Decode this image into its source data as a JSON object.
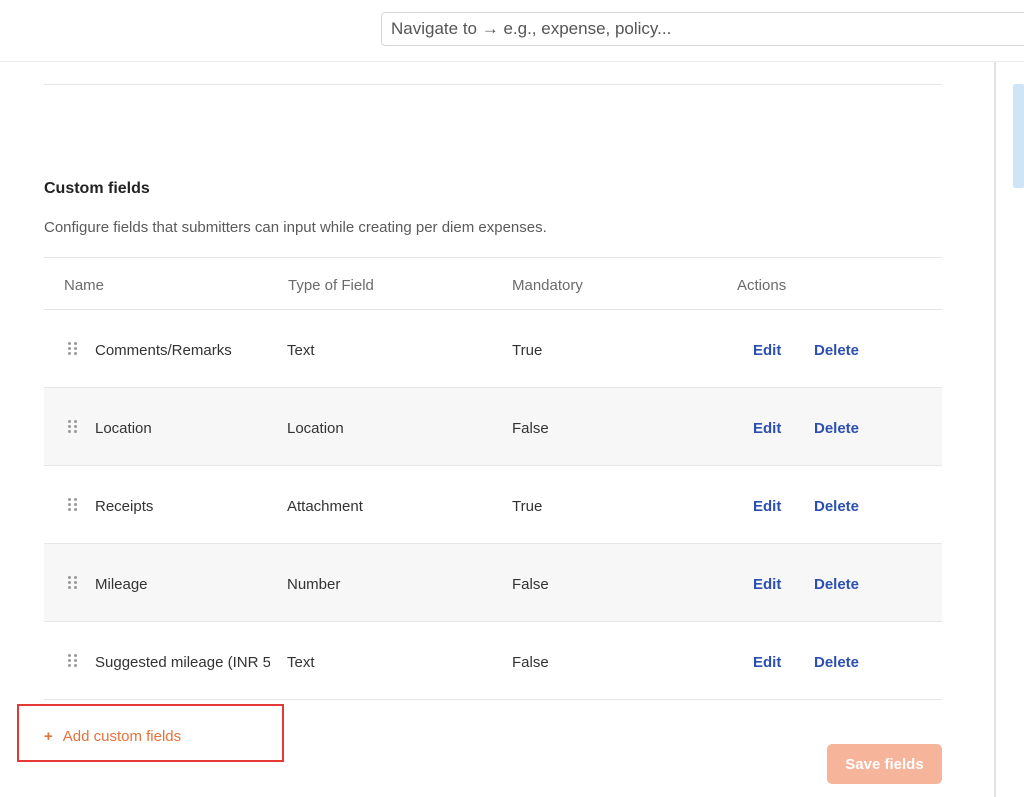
{
  "search": {
    "placeholder": "Navigate to → e.g., expense, policy..."
  },
  "section": {
    "title": "Custom fields",
    "description": "Configure fields that submitters can input while creating per diem expenses."
  },
  "table": {
    "headers": {
      "name": "Name",
      "type": "Type of Field",
      "mandatory": "Mandatory",
      "actions": "Actions"
    },
    "rows": [
      {
        "name": "Comments/Remarks",
        "type": "Text",
        "mandatory": "True",
        "edit": "Edit",
        "delete": "Delete"
      },
      {
        "name": "Location",
        "type": "Location",
        "mandatory": "False",
        "edit": "Edit",
        "delete": "Delete"
      },
      {
        "name": "Receipts",
        "type": "Attachment",
        "mandatory": "True",
        "edit": "Edit",
        "delete": "Delete"
      },
      {
        "name": "Mileage",
        "type": "Number",
        "mandatory": "False",
        "edit": "Edit",
        "delete": "Delete"
      },
      {
        "name": "Suggested mileage (INR 5,",
        "type": "Text",
        "mandatory": "False",
        "edit": "Edit",
        "delete": "Delete"
      }
    ]
  },
  "add_button": {
    "icon": "plus-icon",
    "label": "Add custom fields"
  },
  "save_button": {
    "label": "Save fields"
  },
  "colors": {
    "accent": "#e8713a",
    "link": "#2c4fb0",
    "save_disabled": "#f6b49a",
    "highlight_box": "#e53935"
  }
}
